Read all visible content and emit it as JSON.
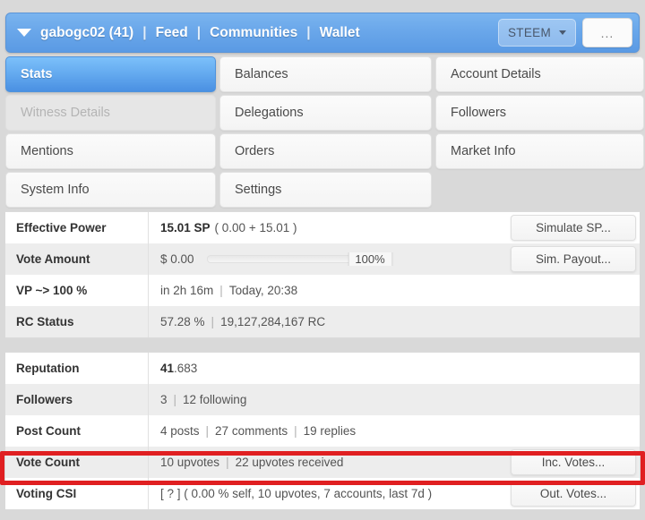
{
  "header": {
    "caret_icon": "caret-down-icon",
    "username": "gabogc02 (41)",
    "separator": "|",
    "nav": [
      {
        "label": "Feed"
      },
      {
        "label": "Communities"
      },
      {
        "label": "Wallet"
      }
    ],
    "token": {
      "label": "STEEM",
      "caret_icon": "chevron-down-icon"
    },
    "more_button": "..."
  },
  "tabs": [
    {
      "label": "Stats",
      "state": "active"
    },
    {
      "label": "Balances",
      "state": "normal"
    },
    {
      "label": "Account Details",
      "state": "normal"
    },
    {
      "label": "Witness Details",
      "state": "disabled"
    },
    {
      "label": "Delegations",
      "state": "normal"
    },
    {
      "label": "Followers",
      "state": "normal"
    },
    {
      "label": "Mentions",
      "state": "normal"
    },
    {
      "label": "Orders",
      "state": "normal"
    },
    {
      "label": "Market Info",
      "state": "normal"
    },
    {
      "label": "System Info",
      "state": "normal"
    },
    {
      "label": "Settings",
      "state": "normal"
    },
    {
      "label": "",
      "state": "empty"
    }
  ],
  "stats_top": {
    "effective_power": {
      "label": "Effective Power",
      "amount": "15.01 SP",
      "breakdown": "( 0.00 + 15.01 )",
      "action": "Simulate SP..."
    },
    "vote_amount": {
      "label": "Vote Amount",
      "amount": "$ 0.00",
      "percent": "100%",
      "action": "Sim. Payout..."
    },
    "vp_100": {
      "label": "VP ~> 100 %",
      "eta": "in 2h 16m",
      "pipe": "|",
      "time": "Today, 20:38"
    },
    "rc_status": {
      "label": "RC Status",
      "percent": "57.28 %",
      "pipe": "|",
      "amount": "19,127,284,167 RC"
    }
  },
  "stats_bottom": {
    "reputation": {
      "label": "Reputation",
      "value_strong": "41",
      "value_rest": ".683"
    },
    "followers": {
      "label": "Followers",
      "count": "3",
      "pipe": "|",
      "following": "12 following"
    },
    "post_count": {
      "label": "Post Count",
      "posts": "4 posts",
      "pipe1": "|",
      "comments": "27 comments",
      "pipe2": "|",
      "replies": "19 replies"
    },
    "vote_count": {
      "label": "Vote Count",
      "given": "10 upvotes",
      "pipe": "|",
      "received": "22 upvotes received",
      "action": "Inc. Votes..."
    },
    "voting_csi": {
      "label": "Voting CSI",
      "value": "[ ? ] ( 0.00 % self, 10 upvotes, 7 accounts, last 7d )",
      "action": "Out. Votes..."
    }
  },
  "colors": {
    "header_blue": "#6aa7ea",
    "active_tab_blue": "#4a90e2",
    "highlight_red": "#e01f21",
    "page_background": "#d9d9d9",
    "row_alt": "#ededed"
  }
}
